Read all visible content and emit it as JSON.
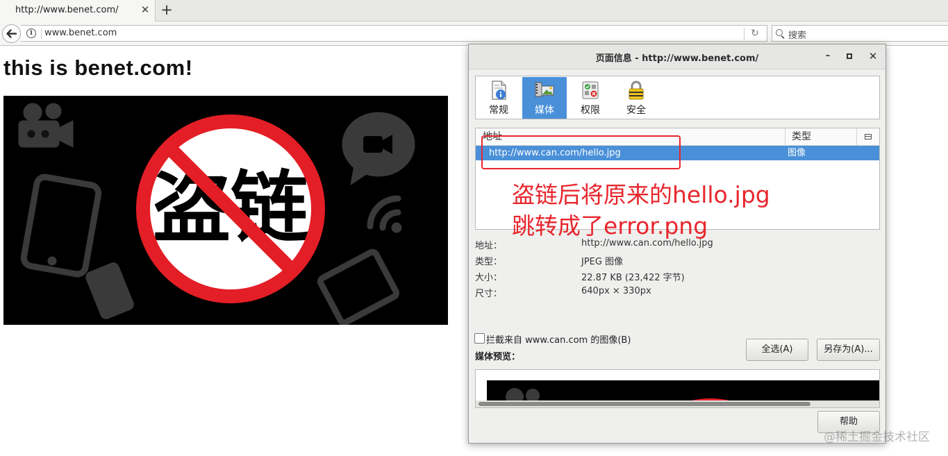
{
  "browser": {
    "tab_title": "http://www.benet.com/",
    "tab_close": "✕",
    "new_tab": "+",
    "back": "🡐",
    "url": "www.benet.com",
    "reload": "↻",
    "search_placeholder": "搜索"
  },
  "page": {
    "heading": "this is benet.com!",
    "hero_text": "盗链"
  },
  "dialog": {
    "title": "页面信息 - http://www.benet.com/",
    "minimize": "–",
    "close": "✕",
    "tabs": [
      {
        "label": "常规",
        "icon": "document-info-icon"
      },
      {
        "label": "媒体",
        "icon": "media-icon",
        "active": true
      },
      {
        "label": "权限",
        "icon": "permissions-icon"
      },
      {
        "label": "安全",
        "icon": "lock-icon"
      }
    ],
    "media_list": {
      "columns": [
        "地址",
        "类型"
      ],
      "rows": [
        {
          "address": "http://www.can.com/hello.jpg",
          "type": "图像"
        }
      ]
    },
    "properties": [
      {
        "key": "地址：",
        "value": "http://www.can.com/hello.jpg"
      },
      {
        "key": "类型：",
        "value": "JPEG 图像"
      },
      {
        "key": "大小：",
        "value": "22.87 KB (23,422 字节)"
      },
      {
        "key": "尺寸：",
        "value": "640px × 330px"
      }
    ],
    "block_images_label": "拦截来自 www.can.com 的图像(B)",
    "select_all_button": "全选(A)",
    "save_as_button": "另存为(A)...",
    "preview_label": "媒体预览：",
    "help_button": "帮助"
  },
  "annotation": {
    "line1": "盗链后将原来的hello.jpg",
    "line2": "跳转成了error.png",
    "color": "#e8262d"
  },
  "watermark": "@稀土掘金技术社区",
  "colors": {
    "accent": "#4a90d9",
    "no_sign_red": "#e41e26"
  }
}
